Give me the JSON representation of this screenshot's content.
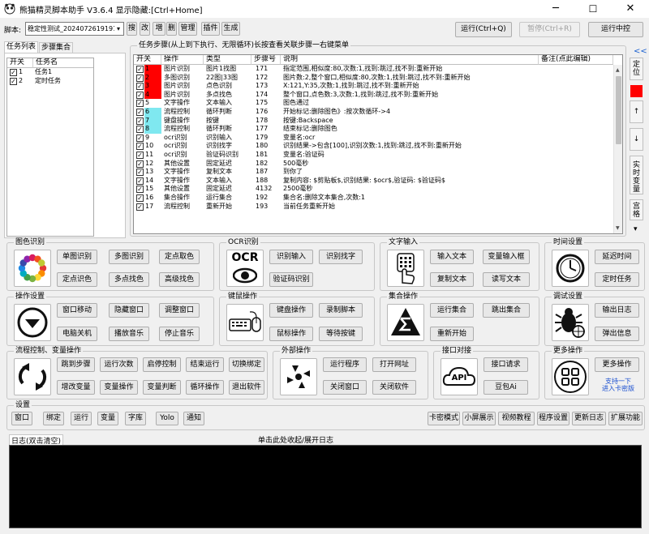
{
  "window": {
    "title": "熊猫精灵脚本助手  V3.6.4  显示隐藏:[Ctrl+Home]",
    "minimize": "─",
    "maximize": "☐",
    "close": "✕"
  },
  "toolbar": {
    "script_label": "脚本:",
    "script_value": "稳定性测试_20240726191919",
    "script_arrow": "▾",
    "buttons": [
      "搜",
      "改",
      "増",
      "删",
      "管理",
      "插件",
      "生成"
    ],
    "run": "运行(Ctrl+Q)",
    "pause": "暂停(Ctrl+R)",
    "run_mid": "运行中控"
  },
  "task_list": {
    "tabs": [
      "任务列表",
      "步骤集合"
    ],
    "columns": [
      "开关",
      "任务名"
    ],
    "rows": [
      {
        "checked": true,
        "num": "1",
        "name": "任务1"
      },
      {
        "checked": true,
        "num": "2",
        "name": "定时任务"
      }
    ]
  },
  "steps": {
    "title": "任务步骤(从上到下执行、无限循环)长按查看关联步骤一右键菜单",
    "columns": [
      "开关",
      "操作",
      "类型",
      "步骤号",
      "说明",
      "备注(点此编辑)"
    ],
    "rows": [
      {
        "checked": true,
        "num": "1",
        "color": "#ff0000",
        "op": "图片识别",
        "type": "图片1找图",
        "step": "171",
        "desc": "指定范围,相似度:80,次数:1,找到:跳过,找不到:重新开始"
      },
      {
        "checked": true,
        "num": "2",
        "color": "#ff0000",
        "op": "多图识别",
        "type": "22图|33图",
        "step": "172",
        "desc": "图片数:2,整个窗口,相似度:80,次数:1,找到:跳过,找不到:重新开始"
      },
      {
        "checked": true,
        "num": "3",
        "color": "#ff0000",
        "op": "图片识别",
        "type": "点色识别",
        "step": "173",
        "desc": "X:121,Y:35,次数:1,找到:跳过,找不到:重新开始"
      },
      {
        "checked": true,
        "num": "4",
        "color": "#ff0000",
        "op": "图片识别",
        "type": "多点找色",
        "step": "174",
        "desc": "整个窗口,点色数:3,次数:1,找到:跳过,找不到:重新开始"
      },
      {
        "checked": true,
        "num": "5",
        "color": "",
        "op": "文字操作",
        "type": "文本输入",
        "step": "175",
        "desc": "图色通过"
      },
      {
        "checked": true,
        "num": "6",
        "color": "#7fe8f0",
        "op": "流程控制",
        "type": "循环判断",
        "step": "176",
        "desc": "开始标记:删除图色》:按次数循环->4"
      },
      {
        "checked": true,
        "num": "7",
        "color": "#7fe8f0",
        "op": "键盘操作",
        "type": "按键",
        "step": "178",
        "desc": "按键:Backspace"
      },
      {
        "checked": true,
        "num": "8",
        "color": "#7fe8f0",
        "op": "流程控制",
        "type": "循环判断",
        "step": "177",
        "desc": "结束标记:删除图色"
      },
      {
        "checked": true,
        "num": "9",
        "color": "",
        "op": "ocr识别",
        "type": "识别输入",
        "step": "179",
        "desc": "变量名:ocr"
      },
      {
        "checked": true,
        "num": "10",
        "color": "",
        "op": "ocr识别",
        "type": "识别找字",
        "step": "180",
        "desc": "识别结果->包含[100],识别次数:1,找到:跳过,找不到:重新开始"
      },
      {
        "checked": true,
        "num": "11",
        "color": "",
        "op": "ocr识别",
        "type": "验证码识别",
        "step": "181",
        "desc": "变量名:验证码"
      },
      {
        "checked": true,
        "num": "12",
        "color": "",
        "op": "其他设置",
        "type": "固定延迟",
        "step": "182",
        "desc": "500毫秒"
      },
      {
        "checked": true,
        "num": "13",
        "color": "",
        "op": "文字操作",
        "type": "复制文本",
        "step": "187",
        "desc": "到你了"
      },
      {
        "checked": true,
        "num": "14",
        "color": "",
        "op": "文字操作",
        "type": "文本输入",
        "step": "188",
        "desc": "复制内容: $剪贴板$,识别结果: $ocr$,验证码: $验证码$"
      },
      {
        "checked": true,
        "num": "15",
        "color": "",
        "op": "其他设置",
        "type": "固定延迟",
        "step": "4132",
        "desc": "2500毫秒"
      },
      {
        "checked": true,
        "num": "16",
        "color": "",
        "op": "集合操作",
        "type": "运行集合",
        "step": "192",
        "desc": "集合名:删除文本集合,次数:1"
      },
      {
        "checked": true,
        "num": "17",
        "color": "",
        "op": "流程控制",
        "type": "重新开始",
        "step": "193",
        "desc": "当前任务重新开始"
      }
    ]
  },
  "side": {
    "collapse": "<<",
    "locate": "定位",
    "up": "↑",
    "down": "↓",
    "bind_var": "实时变量",
    "grid": "宫格",
    "expand": "▾"
  },
  "groups": {
    "image": {
      "title": "图色识别",
      "buttons": [
        "单图识别",
        "多图识别",
        "定点取色",
        "定点识色",
        "多点找色",
        "高级找色"
      ]
    },
    "ocr": {
      "title": "OCR识别",
      "icon_text": "OCR",
      "buttons": [
        "识别输入",
        "识别找字",
        "验证码识别"
      ]
    },
    "text": {
      "title": "文字输入",
      "buttons": [
        "输入文本",
        "变量输入框",
        "复制文本",
        "读写文本"
      ]
    },
    "time": {
      "title": "时间设置",
      "buttons": [
        "延迟时间",
        "定时任务"
      ]
    },
    "op": {
      "title": "操作设置",
      "buttons": [
        "窗口移动",
        "隐藏窗口",
        "调整窗口",
        "电脑关机",
        "播放音乐",
        "停止音乐"
      ]
    },
    "km": {
      "title": "键鼠操作",
      "buttons": [
        "键盘操作",
        "录制脚本",
        "鼠标操作",
        "等待按键"
      ]
    },
    "set": {
      "title": "集合操作",
      "buttons": [
        "运行集合",
        "跳出集合",
        "重新开始"
      ]
    },
    "debug": {
      "title": "调试设置",
      "buttons": [
        "输出日志",
        "弹出信息"
      ]
    },
    "flow": {
      "title": "流程控制、变量操作",
      "buttons": [
        "跳到步骤",
        "运行次数",
        "启停控制",
        "结束运行",
        "切换绑定",
        "增改变量",
        "变量操作",
        "变量判断",
        "循环操作",
        "退出软件"
      ]
    },
    "ext": {
      "title": "外部操作",
      "buttons": [
        "运行程序",
        "打开网址",
        "关闭窗口",
        "关闭软件"
      ]
    },
    "api": {
      "title": "接口对接",
      "icon_text": "API",
      "buttons": [
        "接口请求",
        "豆包Ai"
      ]
    },
    "more": {
      "title": "更多操作",
      "buttons": [
        "更多操作"
      ],
      "link": [
        "支持一下",
        "进入卡密版"
      ]
    }
  },
  "settings": {
    "title": "设置",
    "left": [
      "窗口",
      "绑定",
      "运行",
      "变量",
      "字库",
      "Yolo",
      "通知"
    ],
    "right": [
      "卡密模式",
      "小屏展示",
      "视频教程",
      "程序设置",
      "更新日志",
      "扩展功能"
    ]
  },
  "log": {
    "title": "日志(双击清空)",
    "toggle": "单击此处收起/展开日志"
  },
  "colors": {
    "red": "#ff0000",
    "cyan": "#7fe8f0",
    "accent": "#0a64c8",
    "selected": "#cce8ff"
  }
}
